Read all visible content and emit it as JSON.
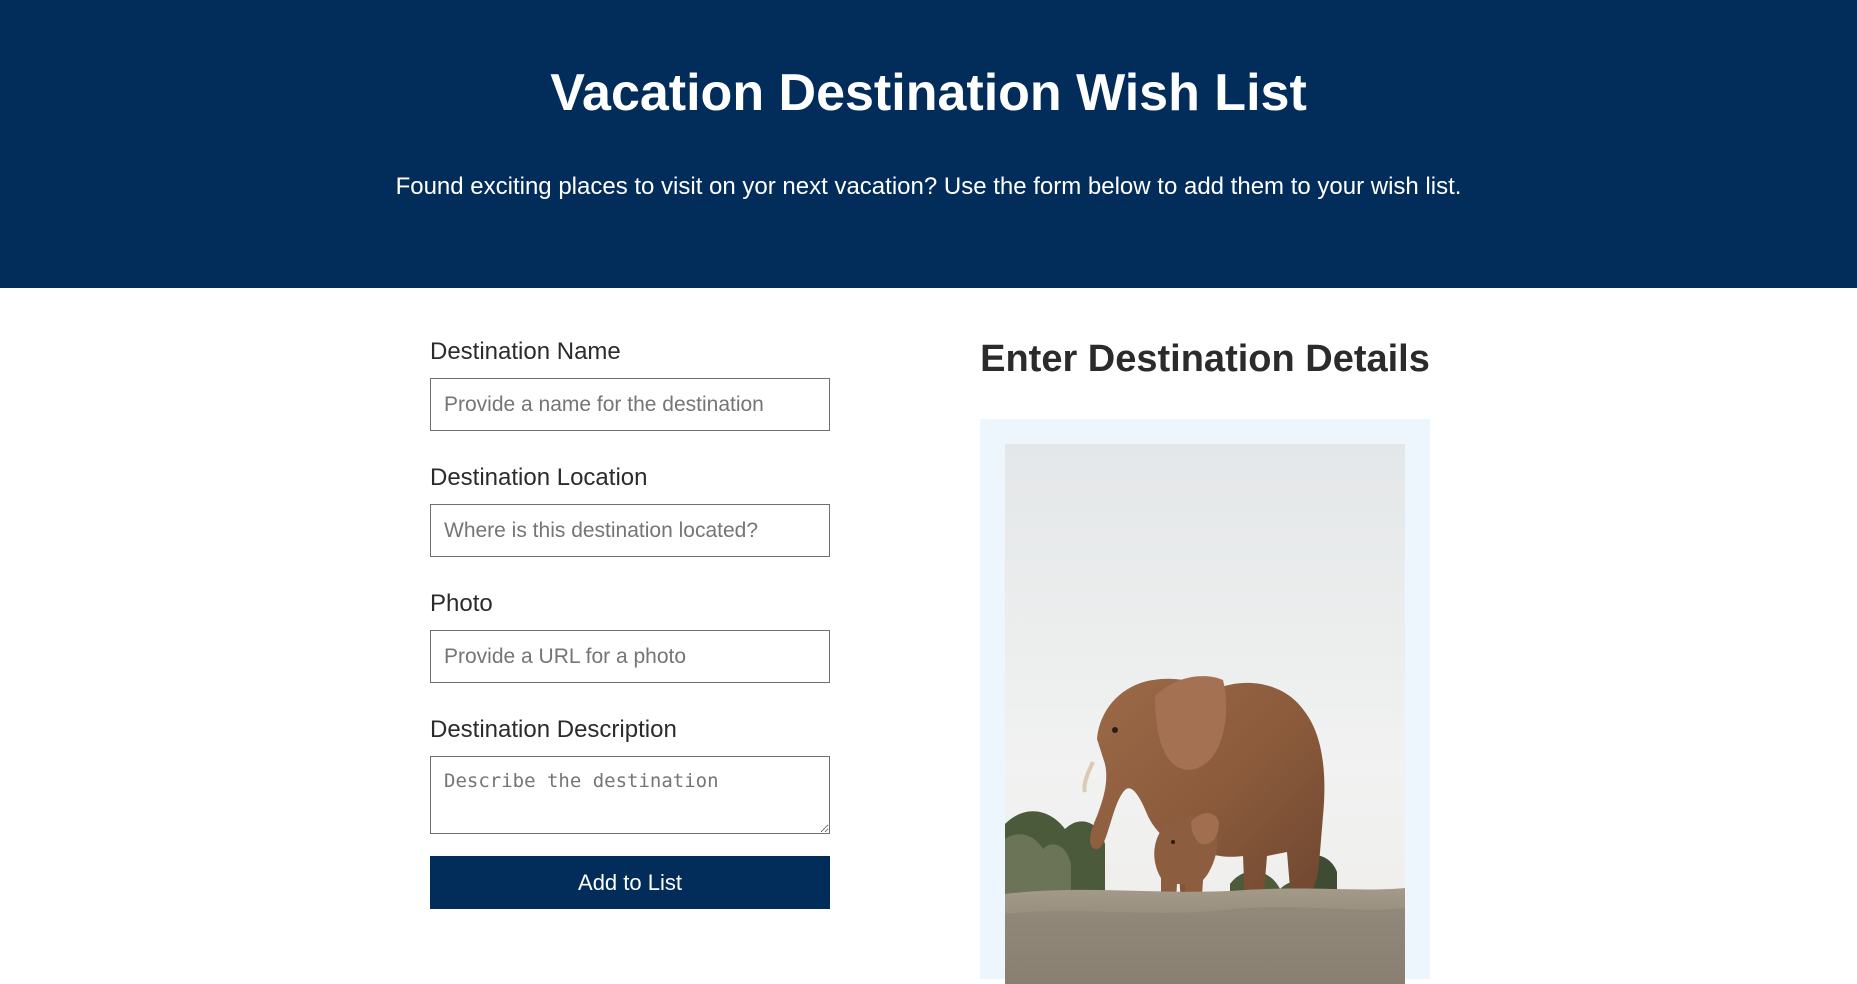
{
  "colors": {
    "brand": "#022d5a",
    "card_background": "#eef6fd"
  },
  "header": {
    "title": "Vacation Destination Wish List",
    "subtitle": "Found exciting places to visit on yor next vacation? Use the form below to add them to your wish list."
  },
  "form": {
    "name": {
      "label": "Destination Name",
      "placeholder": "Provide a name for the destination",
      "value": ""
    },
    "location": {
      "label": "Destination Location",
      "placeholder": "Where is this destination located?",
      "value": ""
    },
    "photo": {
      "label": "Photo",
      "placeholder": "Provide a URL for a photo",
      "value": ""
    },
    "description": {
      "label": "Destination Description",
      "placeholder": "Describe the destination",
      "value": ""
    },
    "submit_label": "Add to List"
  },
  "details": {
    "title": "Enter Destination Details",
    "photo_subject": "elephant-with-calf-photo"
  }
}
